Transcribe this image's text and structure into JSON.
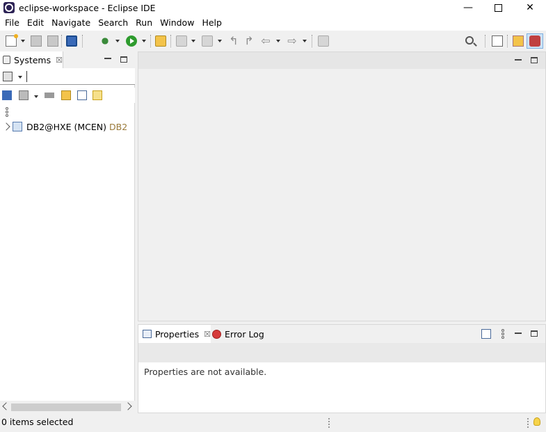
{
  "window": {
    "title": "eclipse-workspace - Eclipse IDE",
    "controls": {
      "minimize": "—",
      "close": "✕"
    }
  },
  "menu": {
    "items": [
      "File",
      "Edit",
      "Navigate",
      "Search",
      "Run",
      "Window",
      "Help"
    ]
  },
  "systems_view": {
    "tab_label": "Systems",
    "tab_close": "☒",
    "tree": [
      {
        "label": "DB2@HXE (MCEN)",
        "type": "DB2"
      }
    ],
    "icons": [
      "systems-icon",
      "new-connection-icon",
      "collapse-icon",
      "link-icon"
    ]
  },
  "properties_view": {
    "tab_label": "Properties",
    "tab_close": "☒",
    "error_log_tab": "Error Log",
    "message": "Properties are not available."
  },
  "status": {
    "text": "0 items selected"
  }
}
